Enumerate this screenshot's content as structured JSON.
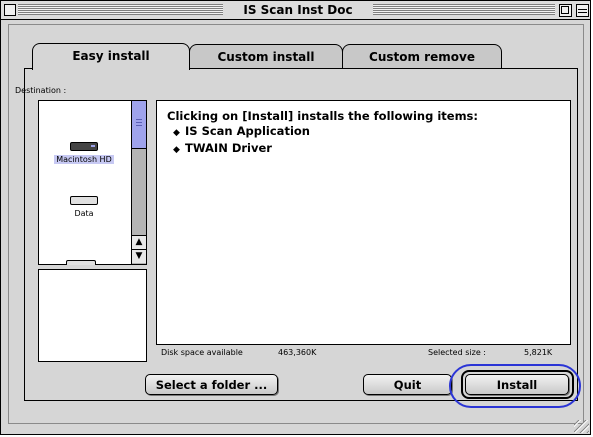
{
  "window": {
    "title": "IS Scan Inst Doc"
  },
  "tabs": [
    {
      "label": "Easy install",
      "active": true
    },
    {
      "label": "Custom install",
      "active": false
    },
    {
      "label": "Custom remove",
      "active": false
    }
  ],
  "destination": {
    "label": "Destination :",
    "disks": [
      {
        "name": "Macintosh HD",
        "selected": true,
        "icon": "hard-drive-icon"
      },
      {
        "name": "Data",
        "selected": false,
        "icon": "hard-drive-icon"
      }
    ]
  },
  "info": {
    "heading": "Clicking on [Install] installs the following items:",
    "items": [
      "IS Scan Application",
      "TWAIN Driver"
    ]
  },
  "status": {
    "disk_space_label": "Disk space available",
    "disk_space_value": "463,360K",
    "selected_size_label": "Selected size :",
    "selected_size_value": "5,821K"
  },
  "buttons": {
    "select_folder": "Select a folder ...",
    "quit": "Quit",
    "install": "Install"
  },
  "colors": {
    "highlight": "#2b35d6",
    "selection": "#9fa3ec"
  }
}
